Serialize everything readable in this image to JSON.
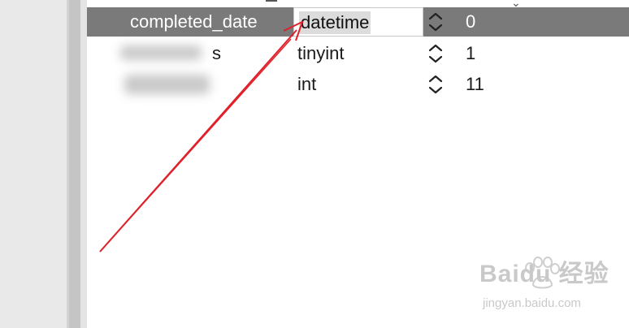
{
  "columns_table": {
    "rows": [
      {
        "name": "completed_date",
        "type": "datetime",
        "length": "0",
        "selected": true
      },
      {
        "name_visible_suffix": "s",
        "type": "tinyint",
        "length": "1"
      },
      {
        "type": "int",
        "length": "11"
      }
    ]
  },
  "watermark": {
    "brand": "Baidu 经验",
    "url": "jingyan.baidu.com"
  },
  "colors": {
    "selected_row": "#7a7a7a",
    "annotation_arrow": "#e0202a"
  },
  "icons": {
    "stepper": "updown-chevron-icon"
  }
}
